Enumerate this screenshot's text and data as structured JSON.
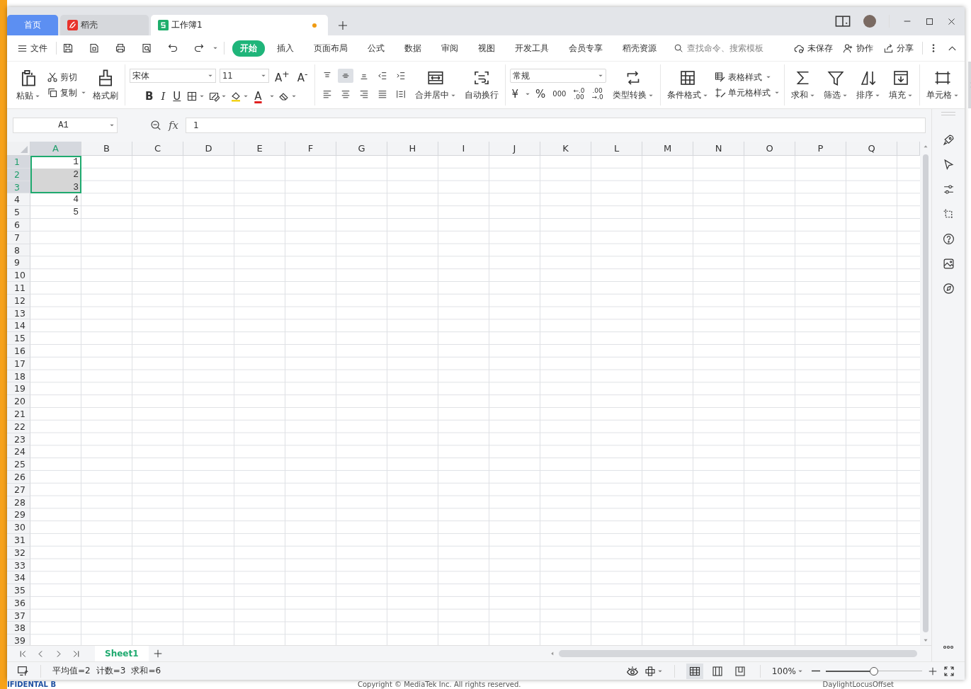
{
  "window": {
    "tabs": [
      {
        "label": "首页",
        "kind": "home",
        "selected": false
      },
      {
        "label": "稻壳",
        "kind": "docer",
        "selected": false
      },
      {
        "label": "工作簿1",
        "kind": "sheet",
        "selected": true,
        "modified": true
      }
    ]
  },
  "menu_bar": {
    "file": "文件",
    "tabs": [
      {
        "label": "开始",
        "selected": true
      },
      {
        "label": "插入",
        "selected": false
      },
      {
        "label": "页面布局",
        "selected": false
      },
      {
        "label": "公式",
        "selected": false
      },
      {
        "label": "数据",
        "selected": false
      },
      {
        "label": "审阅",
        "selected": false
      },
      {
        "label": "视图",
        "selected": false
      },
      {
        "label": "开发工具",
        "selected": false
      },
      {
        "label": "会员专享",
        "selected": false
      },
      {
        "label": "稻壳资源",
        "selected": false
      }
    ],
    "search": {
      "placeholder": "查找命令、搜索模板"
    },
    "actions": [
      "未保存",
      "协作",
      "分享"
    ]
  },
  "ribbon": {
    "clipboard": {
      "paste": "粘贴",
      "cut": "剪切",
      "copy": "复制",
      "format_painter": "格式刷"
    },
    "font": {
      "family": "宋体",
      "size": "11",
      "grow": "A$^{+}$",
      "shrink": "A$^{-}$",
      "bold": "B",
      "italic": "I",
      "underline": "U",
      "font_color_button": "A"
    },
    "alignment": {
      "vertical": [
        {
          "selected": false
        },
        {
          "selected": true
        },
        {
          "selected": false
        }
      ],
      "merge": "合并居中",
      "wrap": "自动换行"
    },
    "number": {
      "format": "常规",
      "currency": "¥",
      "percent": "%",
      "thousands": "000",
      "decimal_add": [
        "←.0",
        ".00"
      ],
      "decimal_remove": [
        ".00",
        "→.0"
      ],
      "convert": "类型转换"
    },
    "styles": {
      "conditional": "条件格式",
      "table_style": "表格样式",
      "cell_style": "单元格样式"
    },
    "editing": {
      "sum": "求和",
      "filter": "筛选",
      "sort": "排序",
      "fill": "填充",
      "cells": "单元格"
    }
  },
  "formula_bar": {
    "name_box": "A1",
    "fx": "fx",
    "formula": "1"
  },
  "sheet": {
    "columns": [
      {
        "label": "A",
        "selected": true
      },
      {
        "label": "B",
        "selected": false
      },
      {
        "label": "C",
        "selected": false
      },
      {
        "label": "D",
        "selected": false
      },
      {
        "label": "E",
        "selected": false
      },
      {
        "label": "F",
        "selected": false
      },
      {
        "label": "G",
        "selected": false
      },
      {
        "label": "H",
        "selected": false
      },
      {
        "label": "I",
        "selected": false
      },
      {
        "label": "J",
        "selected": false
      },
      {
        "label": "K",
        "selected": false
      },
      {
        "label": "L",
        "selected": false
      },
      {
        "label": "M",
        "selected": false
      },
      {
        "label": "N",
        "selected": false
      },
      {
        "label": "O",
        "selected": false
      },
      {
        "label": "P",
        "selected": false
      },
      {
        "label": "Q",
        "selected": false
      }
    ],
    "rows": [
      {
        "label": "1",
        "selected": true,
        "cells": [
          {
            "value": "1",
            "selected": true,
            "active": true
          }
        ]
      },
      {
        "label": "2",
        "selected": true,
        "cells": [
          {
            "value": "2",
            "selected": true,
            "active": false
          }
        ]
      },
      {
        "label": "3",
        "selected": true,
        "cells": [
          {
            "value": "3",
            "selected": true,
            "active": false
          }
        ]
      },
      {
        "label": "4",
        "selected": false,
        "cells": [
          {
            "value": "4",
            "selected": false,
            "active": false
          }
        ]
      },
      {
        "label": "5",
        "selected": false,
        "cells": [
          {
            "value": "5",
            "selected": false,
            "active": false
          }
        ]
      },
      {
        "label": "6",
        "selected": false
      },
      {
        "label": "7",
        "selected": false
      },
      {
        "label": "8",
        "selected": false
      },
      {
        "label": "9",
        "selected": false
      },
      {
        "label": "10",
        "selected": false
      },
      {
        "label": "11",
        "selected": false
      },
      {
        "label": "12",
        "selected": false
      },
      {
        "label": "13",
        "selected": false
      },
      {
        "label": "14",
        "selected": false
      },
      {
        "label": "15",
        "selected": false
      },
      {
        "label": "16",
        "selected": false
      },
      {
        "label": "17",
        "selected": false
      },
      {
        "label": "18",
        "selected": false
      },
      {
        "label": "19",
        "selected": false
      },
      {
        "label": "20",
        "selected": false
      },
      {
        "label": "21",
        "selected": false
      },
      {
        "label": "22",
        "selected": false
      },
      {
        "label": "23",
        "selected": false
      },
      {
        "label": "24",
        "selected": false
      },
      {
        "label": "25",
        "selected": false
      },
      {
        "label": "26",
        "selected": false
      },
      {
        "label": "27",
        "selected": false
      },
      {
        "label": "28",
        "selected": false
      },
      {
        "label": "29",
        "selected": false
      },
      {
        "label": "30",
        "selected": false
      },
      {
        "label": "31",
        "selected": false
      },
      {
        "label": "32",
        "selected": false
      },
      {
        "label": "33",
        "selected": false
      },
      {
        "label": "34",
        "selected": false
      },
      {
        "label": "35",
        "selected": false
      },
      {
        "label": "36",
        "selected": false
      },
      {
        "label": "37",
        "selected": false
      },
      {
        "label": "38",
        "selected": false
      },
      {
        "label": "39",
        "selected": false
      }
    ]
  },
  "sheet_tabs": [
    {
      "label": "Sheet1",
      "selected": true
    }
  ],
  "status_bar": {
    "stats": [
      "平均值=2",
      "计数=3",
      "求和=6"
    ],
    "views": [
      {
        "selected": true
      },
      {
        "selected": false
      },
      {
        "selected": false
      }
    ],
    "zoom": "100%",
    "zoom_slider": {
      "level": 0.5
    }
  },
  "background": {
    "texts": [
      "IFIDENTAL B",
      "Copyright © MediaTek Inc. All rights reserved.",
      "DaylightLocusOffset"
    ]
  }
}
